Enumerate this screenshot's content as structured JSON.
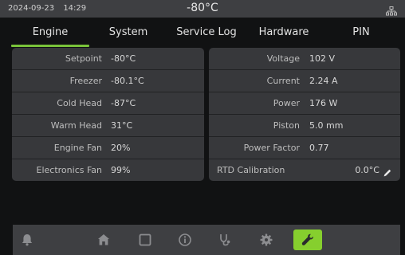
{
  "status": {
    "date": "2024-09-23",
    "time": "14:29",
    "temperature": "-80°C",
    "network_icon": "network-icon"
  },
  "tabs": [
    {
      "label": "Engine",
      "active": true
    },
    {
      "label": "System"
    },
    {
      "label": "Service Log"
    },
    {
      "label": "Hardware"
    },
    {
      "label": "PIN"
    }
  ],
  "left_panel": {
    "rows": [
      {
        "label": "Setpoint",
        "value": "-80°C"
      },
      {
        "label": "Freezer",
        "value": "-80.1°C"
      },
      {
        "label": "Cold Head",
        "value": "-87°C"
      },
      {
        "label": "Warm Head",
        "value": "31°C"
      },
      {
        "label": "Engine Fan",
        "value": "20%"
      },
      {
        "label": "Electronics Fan",
        "value": "99%"
      }
    ]
  },
  "right_panel": {
    "rows": [
      {
        "label": "Voltage",
        "value": "102 V"
      },
      {
        "label": "Current",
        "value": "2.24 A"
      },
      {
        "label": "Power",
        "value": "176 W"
      },
      {
        "label": "Piston",
        "value": "5.0 mm"
      },
      {
        "label": "Power Factor",
        "value": "0.77"
      }
    ],
    "rtd": {
      "label": "RTD Calibration",
      "value": "0.0°C",
      "icon": "pencil-icon"
    }
  },
  "bottom_nav": {
    "icons": [
      "bell-icon",
      "home-icon",
      "square-icon",
      "info-icon",
      "stethoscope-icon",
      "gear-icon",
      "wrench-icon"
    ],
    "active": "wrench-icon",
    "accent": "#86cf2e"
  },
  "colors": {
    "background": "#111213",
    "bar": "#3e3f42",
    "panel": "#37383b",
    "tab_underline": "#79c33a"
  }
}
